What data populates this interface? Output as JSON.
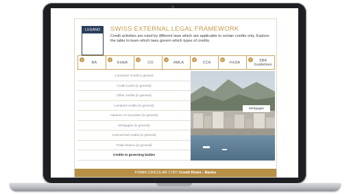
{
  "slide": {
    "logo_text": "LUGANO",
    "title": "SWISS EXTERNAL LEGAL FRAMEWORK",
    "description": "Credit activities are ruled by different laws which are applicable to certain credits only. Explore the table to learn which laws govern which types of credits."
  },
  "tabs": [
    {
      "num": "1",
      "label": "BA"
    },
    {
      "num": "2",
      "label": "EmbA"
    },
    {
      "num": "3",
      "label": "CO"
    },
    {
      "num": "4",
      "label": "AMLA"
    },
    {
      "num": "5",
      "label": "CCA"
    },
    {
      "num": "6",
      "label": "FinSA"
    },
    {
      "num": "7",
      "label": "SBA Guidelines"
    }
  ],
  "credit_list": [
    "Consumer Credit in general",
    "Credit Cards (in general)",
    "Other credits (in general)",
    "Lombard credits (in general)",
    "Advance on securities (in general)",
    "Mortgages (in general)",
    "Commercial credits (in general)",
    "Trade finance (in general)",
    "Credits to governing bodies"
  ],
  "photo_tag": "Mortgages",
  "footer": {
    "prefix": "FINMA CIRCULAR 17/07",
    "bold": "Credit Risks - Banks"
  },
  "colors": {
    "accent": "#c39a4f",
    "footer_bg": "#b78f47",
    "logo_navy": "#2b3f5c"
  }
}
